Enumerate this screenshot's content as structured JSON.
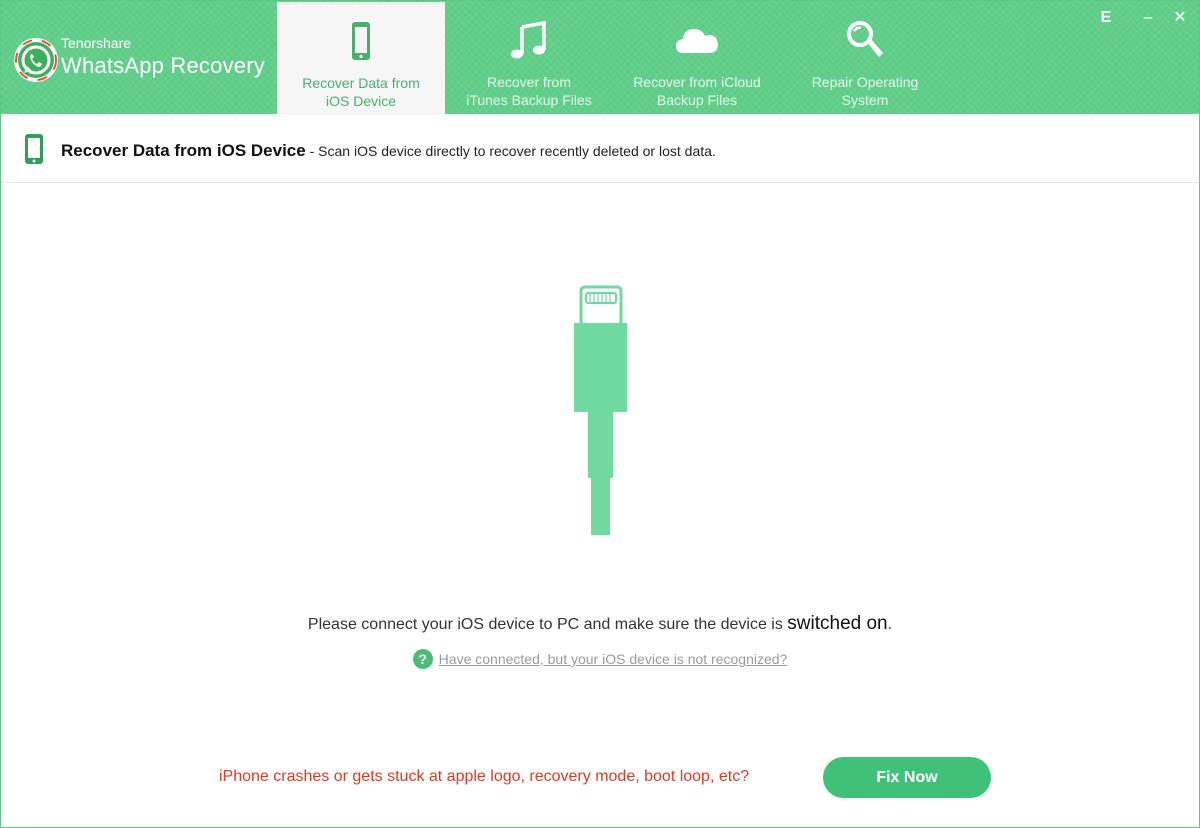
{
  "header": {
    "brand_small": "Tenorshare",
    "brand_big": "WhatsApp Recovery",
    "tabs": [
      {
        "line1": "Recover Data from",
        "line2": "iOS Device",
        "icon": "phone-icon",
        "active": true
      },
      {
        "line1": "Recover from",
        "line2": "iTunes Backup Files",
        "icon": "music-note-icon",
        "active": false
      },
      {
        "line1": "Recover from iCloud",
        "line2": "Backup Files",
        "icon": "cloud-icon",
        "active": false
      },
      {
        "line1": "Repair Operating",
        "line2": "System",
        "icon": "wrench-search-icon",
        "active": false
      }
    ],
    "window_controls": {
      "feedback": "E",
      "minimize": "–",
      "close": "✕"
    }
  },
  "subheader": {
    "title": "Recover Data from iOS Device",
    "description": " - Scan iOS device directly to recover recently deleted or lost data."
  },
  "main": {
    "connect_prefix": "Please connect your iOS device to PC and make sure the device is ",
    "connect_strong": "switched on",
    "connect_suffix": ".",
    "help_icon": "?",
    "help_link": "Have connected, but your iOS device is not recognized?",
    "crash_message": "iPhone crashes or gets stuck at apple logo, recovery mode, boot loop, etc?",
    "fix_button": "Fix Now"
  },
  "colors": {
    "header_green": "#5ccc86",
    "accent_green": "#3fc277",
    "cable_green": "#6fd9a0",
    "warning_red": "#dd3a22"
  }
}
